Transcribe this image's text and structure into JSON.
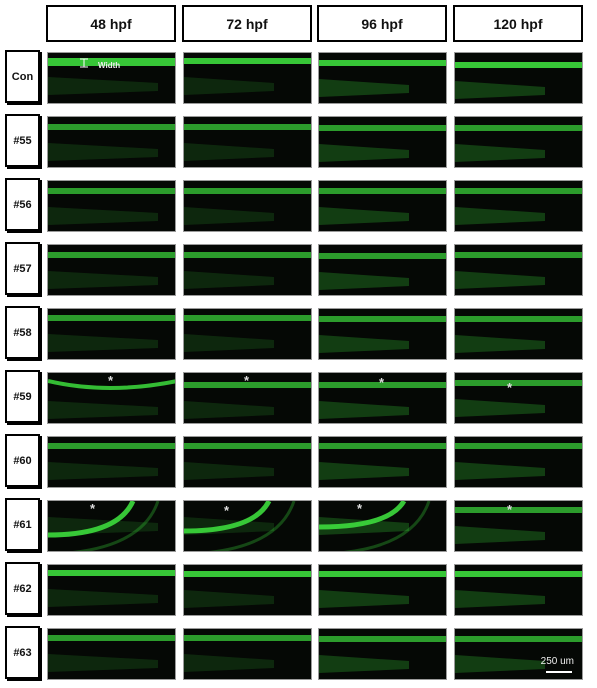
{
  "columns": [
    "48 hpf",
    "72 hpf",
    "96 hpf",
    "120 hpf"
  ],
  "rows": [
    "Con",
    "#55",
    "#56",
    "#57",
    "#58",
    "#59",
    "#60",
    "#61",
    "#62",
    "#63"
  ],
  "annotations": {
    "width_label": "Width",
    "asterisk": "*",
    "asterisk_rows": [
      "#59",
      "#61"
    ],
    "scale_bar": "250 um"
  },
  "colors": {
    "fluorescence": "#3ddc3d",
    "background": "#050805"
  }
}
